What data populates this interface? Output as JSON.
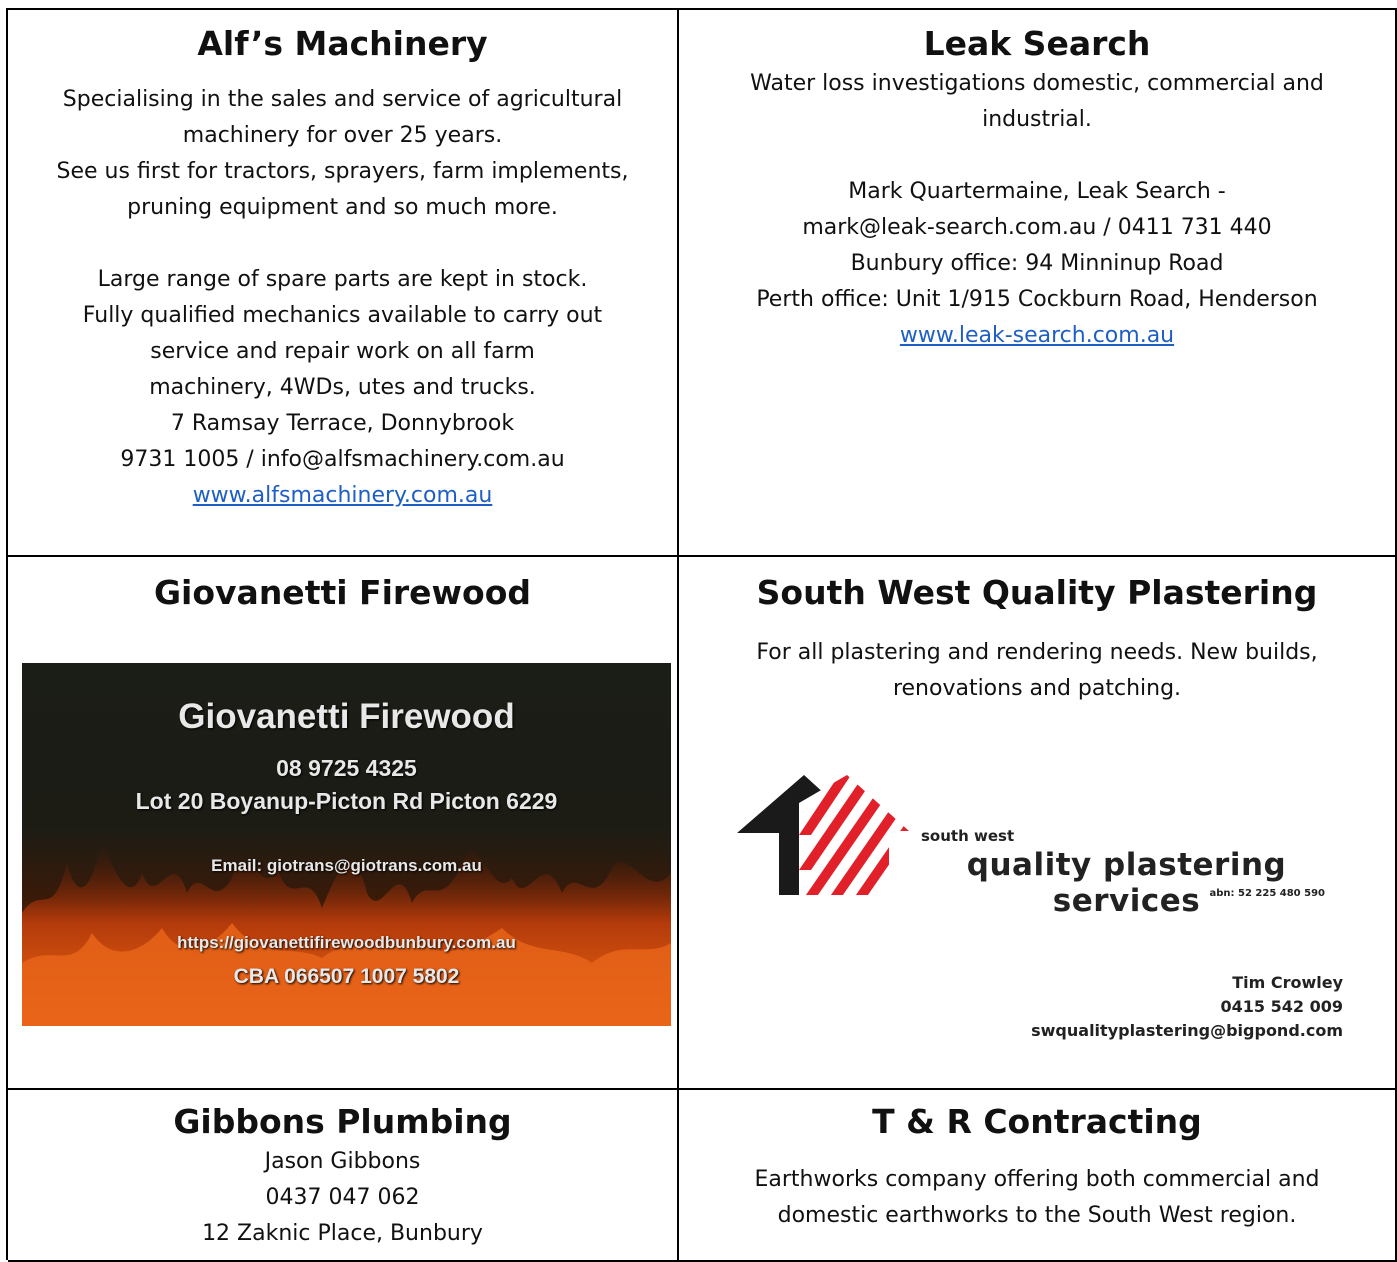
{
  "alfs": {
    "title": "Alf’s Machinery",
    "p1": [
      "Specialising in the sales and service of agricultural",
      "machinery for over 25 years.",
      "See us first for tractors, sprayers, farm implements,",
      "pruning equipment and so much more."
    ],
    "p2": [
      "Large range of spare parts are kept in stock.",
      "Fully qualified mechanics available to carry out",
      "service and repair work on all farm",
      "machinery, 4WDs, utes and trucks.",
      "7 Ramsay Terrace, Donnybrook",
      "9731 1005 / info@alfsmachinery.com.au"
    ],
    "website": "www.alfsmachinery.com.au"
  },
  "leak": {
    "title": "Leak Search",
    "p1": [
      "Water loss investigations domestic, commercial and",
      "industrial."
    ],
    "p2": [
      "Mark Quartermaine, Leak Search -",
      "mark@leak-search.com.au / 0411 731 440",
      "Bunbury office: 94 Minninup Road",
      "Perth office: Unit 1/915 Cockburn Road, Henderson"
    ],
    "website": "www.leak-search.com.au"
  },
  "giovanetti": {
    "title": "Giovanetti Firewood",
    "card": {
      "name": "Giovanetti Firewood",
      "phone": "08 9725 4325",
      "address": "Lot 20 Boyanup-Picton Rd Picton 6229",
      "email": "Email: giotrans@giotrans.com.au",
      "url": "https://giovanettifirewoodbunbury.com.au",
      "bank": "CBA 066507 1007 5802"
    }
  },
  "plastering": {
    "title": "South West Quality Plastering",
    "p1": [
      "For all plastering and rendering needs. New builds,",
      "renovations and patching."
    ],
    "logo": {
      "small": "south west",
      "big": "quality plastering services",
      "abn": "abn: 52 225 480 590"
    },
    "contact": [
      "Tim Crowley",
      "0415 542 009",
      "swqualityplastering@bigpond.com"
    ],
    "colors": {
      "roof": "#e1202a",
      "house": "#1a1a1a"
    }
  },
  "gibbons": {
    "title": "Gibbons Plumbing",
    "lines": [
      "Jason Gibbons",
      "0437 047 062",
      "12 Zaknic Place, Bunbury"
    ]
  },
  "tr": {
    "title": "T & R Contracting",
    "p1": [
      "Earthworks company offering both commercial and",
      "domestic earthworks to the South West region."
    ]
  },
  "colors": {
    "link": "#1f5fc4",
    "border": "#000000"
  }
}
